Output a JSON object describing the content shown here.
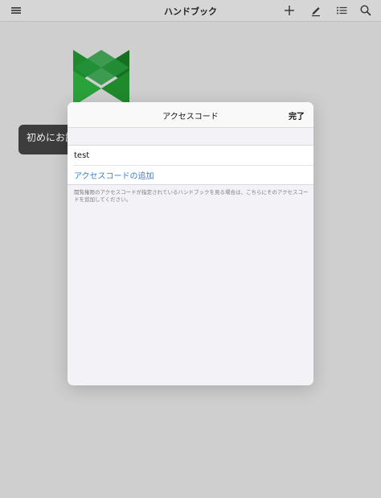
{
  "navbar": {
    "title": "ハンドブック",
    "icons": [
      "menu-icon",
      "plus-icon",
      "edit-icon",
      "list-icon",
      "search-icon"
    ]
  },
  "background": {
    "tooltip_text": "初めにお試",
    "logo_colors": [
      "#1f8a2c",
      "#2aa23a",
      "#14701f"
    ]
  },
  "modal": {
    "title": "アクセスコード",
    "done_label": "完了",
    "access_code_value": "test",
    "add_access_code_label": "アクセスコードの追加",
    "footnote": "閲覧権限のアクセスコードが指定されているハンドブックを見る場合は、こちらにそのアクセスコードを追加してください。"
  },
  "colors": {
    "link": "#2f7fd6",
    "backdrop": "#cfcfcf"
  }
}
